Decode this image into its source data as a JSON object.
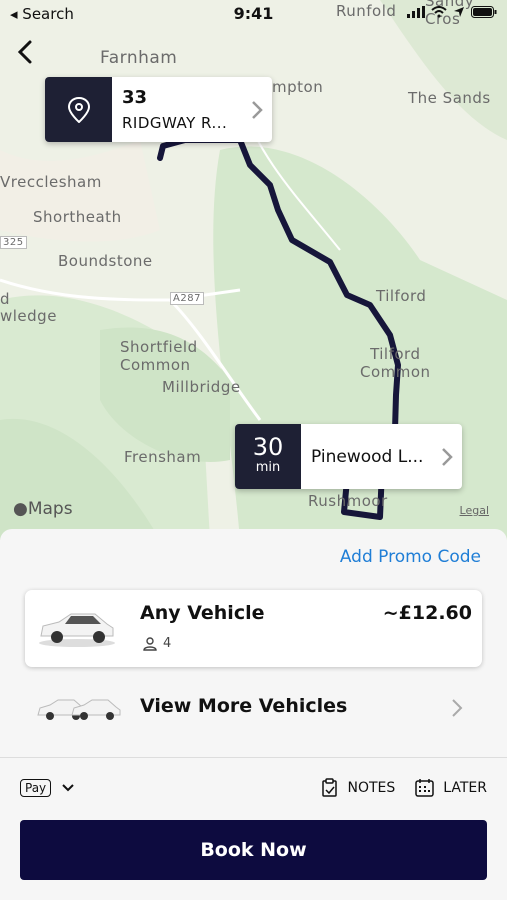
{
  "status_bar": {
    "back_app": "◂ Search",
    "time": "9:41"
  },
  "map": {
    "labels": {
      "runfold": "Runfold",
      "sandy_cross": "Sandy Cros",
      "farnham": "Farnham",
      "compton": "mpton",
      "the_sands": "The Sands",
      "wrecclesham": "Vrecclesham",
      "shortheath": "Shortheath",
      "road_325": "325",
      "boundstone": "Boundstone",
      "road_a287": "A287",
      "tilford": "Tilford",
      "d": "d",
      "wledge": "wledge",
      "shortfield_common": "Shortfield\nCommon",
      "tilford_common": "Tilford\nCommon",
      "millbridge": "Millbridge",
      "frensham": "Frensham",
      "rushmoor": "Rushmoor"
    },
    "maps_logo": "Maps",
    "legal": "Legal"
  },
  "pickup": {
    "line1": "33",
    "line2": "RIDGWAY R..."
  },
  "eta": {
    "value": "30",
    "unit": "min",
    "destination": "Pinewood L..."
  },
  "sheet": {
    "promo": "Add Promo Code",
    "vehicle": {
      "name": "Any Vehicle",
      "seats": "4",
      "price": "~£12.60"
    },
    "more_vehicles": "View More Vehicles",
    "payment_badge": "Pay",
    "notes": "NOTES",
    "later": "LATER",
    "book": "Book Now"
  },
  "colors": {
    "brand_dark": "#0d0b3f",
    "accent_blue": "#1f7ed6"
  }
}
